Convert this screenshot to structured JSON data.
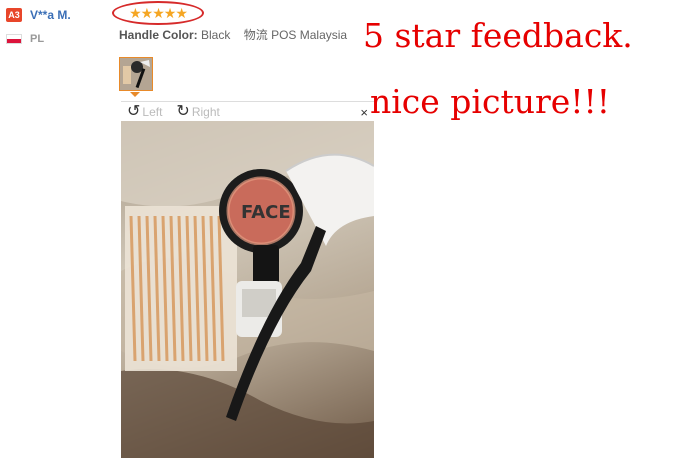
{
  "reviewer": {
    "level_badge": "A3",
    "name": "V**a M.",
    "country": "PL"
  },
  "review": {
    "stars": "★★★★★",
    "rating": 5,
    "attribute_label": "Handle Color:",
    "attribute_value": "Black",
    "shipping_label": "物流",
    "shipping_value": "POS Malaysia"
  },
  "viewer": {
    "rotate_left_label": "Left",
    "rotate_right_label": "Right",
    "close_symbol": "×",
    "photo_text": "FACE"
  },
  "annotations": {
    "line1": "5 star feedback.",
    "line2": "nice picture!!!"
  },
  "colors": {
    "annotation": "#e60000",
    "star": "#f5a623",
    "name_link": "#3b6fb6",
    "thumb_border": "#e88a2a"
  }
}
